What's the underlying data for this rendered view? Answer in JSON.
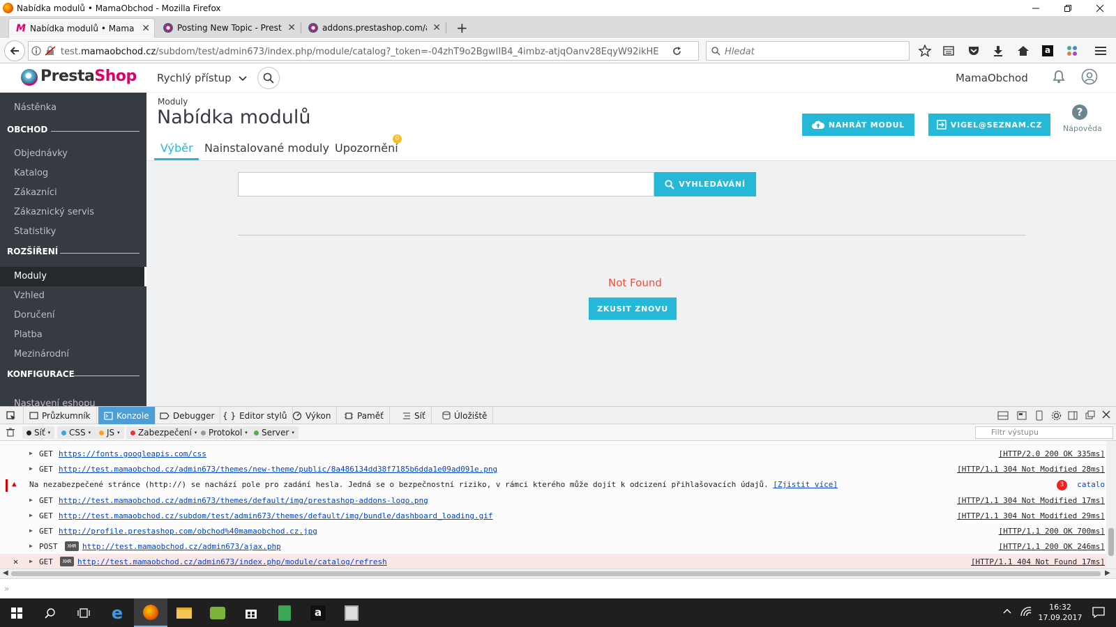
{
  "window": {
    "title": "Nabídka modulů • MamaObchod - Mozilla Firefox"
  },
  "tabs": [
    {
      "label": "Nabídka modulů • MamaOb"
    },
    {
      "label": "Posting New Topic - PrestaS"
    },
    {
      "label": "addons.prestashop.com/adr"
    }
  ],
  "nav": {
    "url_prefix": "test.",
    "url_domain": "mamaobchod.cz",
    "url_rest": "/subdom/test/admin673/index.php/module/catalog?_token=-04zhT9o2BgwIIB4_4imbz-atjqOanv28EqyW92ikHE",
    "search_placeholder": "Hledat"
  },
  "ps_header": {
    "logo_presta": "Presta",
    "logo_shop": "Shop",
    "quick_access": "Rychlý přístup",
    "shop_name": "MamaObchod"
  },
  "sidebar": {
    "dashboard": "Nástěnka",
    "sections": [
      {
        "title": "OBCHOD",
        "items": [
          "Objednávky",
          "Katalog",
          "Zákazníci",
          "Zákaznický servis",
          "Statistiky"
        ]
      },
      {
        "title": "ROZŠÍŘENÍ",
        "items": [
          "Moduly",
          "Vzhled",
          "Doručení",
          "Platba",
          "Mezinárodní"
        ]
      },
      {
        "title": "KONFIGURACE",
        "items": [
          "Nastavení eshopu"
        ]
      }
    ]
  },
  "page": {
    "breadcrumb": "Moduly",
    "title": "Nabídka modulů",
    "tabs": [
      "Výběr",
      "Nainstalované moduly",
      "Upozornění"
    ],
    "notif_count": "0",
    "upload_button": "NAHRÁT MODUL",
    "account_button": "VIGEL@SEZNAM.CZ",
    "help_label": "Nápověda",
    "search_button": "VYHLEDÁVÁNÍ",
    "error_text": "Not Found",
    "retry_button": "ZKUSIT ZNOVU"
  },
  "devtools": {
    "tabs": [
      "Průzkumník",
      "Konzole",
      "Debugger",
      "Editor stylů",
      "Výkon",
      "Paměť",
      "Síť",
      "Úložiště"
    ],
    "filters": [
      "Síť",
      "CSS",
      "JS",
      "Zabezpečení",
      "Protokol",
      "Server"
    ],
    "filter_placeholder": "Filtr výstupu",
    "rows": [
      {
        "method": "GET",
        "url": "https://fonts.googleapis.com/css",
        "status": "[HTTP/2.0 200 OK 335ms]"
      },
      {
        "method": "GET",
        "url": "http://test.mamaobchod.cz/admin673/themes/new-theme/public/8a486134dd38f7185b6dda1e09ad091e.png",
        "status": "[HTTP/1.1 304 Not Modified 28ms]"
      },
      {
        "method": "GET",
        "url": "http://test.mamaobchod.cz/admin673/themes/default/img/prestashop-addons-logo.png",
        "status": "[HTTP/1.1 304 Not Modified 17ms]"
      },
      {
        "method": "GET",
        "url": "http://test.mamaobchod.cz/subdom/test/admin673/themes/default/img/bundle/dashboard_loading.gif",
        "status": "[HTTP/1.1 304 Not Modified 29ms]"
      },
      {
        "method": "GET",
        "url": "http://profile.prestashop.com/obchod%40mamaobchod.cz.jpg",
        "status": "[HTTP/1.1 200 OK 700ms]"
      },
      {
        "method": "POST",
        "url": "http://test.mamaobchod.cz/admin673/ajax.php",
        "status": "[HTTP/1.1 200 OK 246ms]"
      },
      {
        "method": "GET",
        "url": "http://test.mamaobchod.cz/admin673/index.php/module/catalog/refresh",
        "status": "[HTTP/1.1 404 Not Found 17ms]"
      }
    ],
    "xhr_label": "XHR",
    "warning": {
      "text": "Na nezabezpečené stránce (http://) se nachází pole pro zadání hesla. Jedná se o bezpečnostní riziko, v rámci kterého může dojít k odcizení přihlašovacích údajů.",
      "link": "[Zjistit více]",
      "count": "3",
      "source": "catalo"
    },
    "error_marker": "✕"
  },
  "taskbar": {
    "time": "16:32",
    "date": "17.09.2017"
  },
  "colors": {
    "accent": "#25b9d7",
    "sidebar": "#363a41",
    "error": "#f54c3e"
  }
}
